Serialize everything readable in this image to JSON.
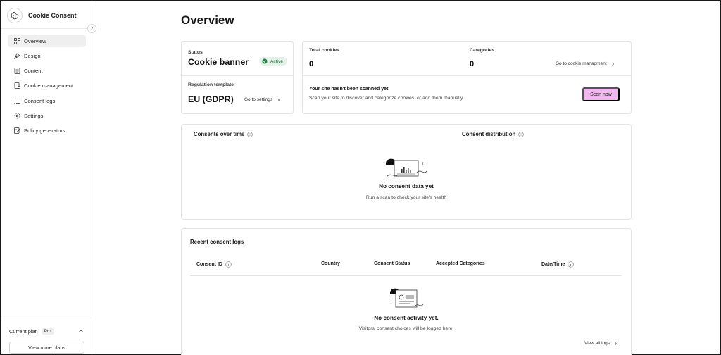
{
  "app": {
    "title": "Cookie Consent"
  },
  "sidebar": {
    "items": [
      {
        "label": "Overview",
        "icon": "grid-icon",
        "active": true
      },
      {
        "label": "Design",
        "icon": "palette-icon",
        "active": false
      },
      {
        "label": "Content",
        "icon": "document-icon",
        "active": false
      },
      {
        "label": "Cookie management",
        "icon": "cookie-icon",
        "active": false
      },
      {
        "label": "Consent logs",
        "icon": "list-icon",
        "active": false
      },
      {
        "label": "Settings",
        "icon": "gear-icon",
        "active": false
      },
      {
        "label": "Policy generators",
        "icon": "policy-icon",
        "active": false
      }
    ],
    "plan": {
      "label": "Current plan",
      "badge": "Pro"
    },
    "plans_button": "View more plans"
  },
  "page": {
    "title": "Overview"
  },
  "status_card": {
    "status_label": "Status",
    "status_value": "Cookie banner",
    "status_badge": "Active",
    "template_label": "Regulation template",
    "template_value": "EU (GDPR)",
    "settings_link": "Go to settings"
  },
  "stats_card": {
    "total_cookies_label": "Total cookies",
    "total_cookies_value": "0",
    "categories_label": "Categories",
    "categories_value": "0",
    "manage_link": "Go to cookie managment",
    "scan_title": "Your site hasn't been scanned yet",
    "scan_desc": "Scan your site to discover and categorize cookies, or add them manually",
    "scan_button": "Scan now"
  },
  "charts_card": {
    "consents_over_time": "Consents over time",
    "consent_distribution": "Consent distribution",
    "empty_title": "No consent data yet",
    "empty_sub": "Run a scan to check your site's health"
  },
  "logs_card": {
    "title": "Recent consent logs",
    "columns": [
      "Consent ID",
      "Country",
      "Consent Status",
      "Accepted Categories",
      "Date/Time"
    ],
    "empty_title": "No consent activity yet.",
    "empty_sub": "Visitors' consent choices will be logged here.",
    "view_all_link": "View all logs"
  },
  "colors": {
    "accent_button": "#f0b8ee",
    "active_badge_bg": "#e3f3e8",
    "active_badge_fg": "#206a3c"
  }
}
